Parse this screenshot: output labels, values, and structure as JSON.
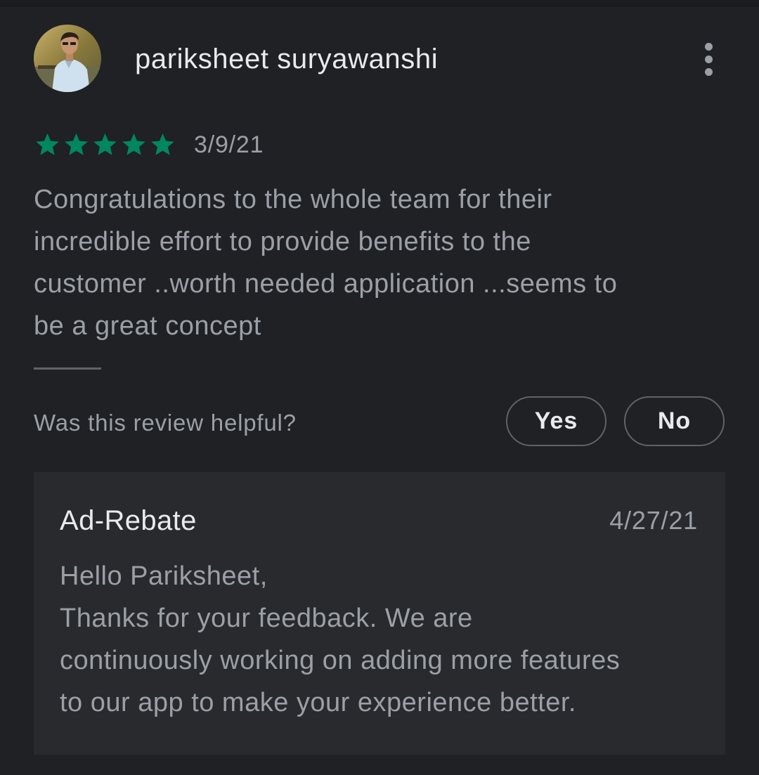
{
  "review": {
    "author_name": "pariksheet suryawanshi",
    "avatar_icon": "user-photo-avatar",
    "menu_icon": "more-vert-icon",
    "rating": 5,
    "rating_max": 5,
    "star_color": "#01875f",
    "date": "3/9/21",
    "text_lines": [
      "Congratulations to the whole team for their",
      "incredible effort to provide benefits to the",
      "customer ..worth needed application ...seems to",
      "be a great concept"
    ]
  },
  "helpful": {
    "question": "Was this review helpful?",
    "yes_label": "Yes",
    "no_label": "No"
  },
  "developer_reply": {
    "name": "Ad-Rebate",
    "date": "4/27/21",
    "lines": [
      "Hello Pariksheet,",
      "Thanks for your feedback. We are",
      "continuously working on adding more features",
      "to our app to make your experience better."
    ]
  }
}
